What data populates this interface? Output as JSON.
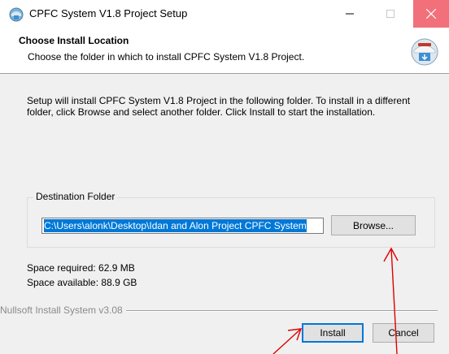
{
  "window": {
    "title": "CPFC System V1.8 Project Setup"
  },
  "header": {
    "title": "Choose Install Location",
    "subtitle": "Choose the folder in which to install CPFC System V1.8 Project."
  },
  "content": {
    "description": "Setup will install CPFC System V1.8 Project in the following folder. To install in a different\nfolder, click Browse and select another folder. Click Install to start the installation.",
    "destination_label": "Destination Folder",
    "destination_value": "C:\\Users\\alonk\\Desktop\\Idan and Alon Project CPFC System",
    "browse_label": "Browse...",
    "space_required": "Space required: 62.9 MB",
    "space_available": "Space available: 88.9 GB"
  },
  "footer": {
    "branding": "Nullsoft Install System v3.08",
    "install_label": "Install",
    "cancel_label": "Cancel"
  },
  "colors": {
    "selection": "#0078d7",
    "close_hover": "#f1707a",
    "annotation_arrow": "#e00000"
  },
  "icons": [
    "installer-app-icon",
    "minimize-icon",
    "maximize-icon",
    "close-icon",
    "installer-logo-icon"
  ]
}
